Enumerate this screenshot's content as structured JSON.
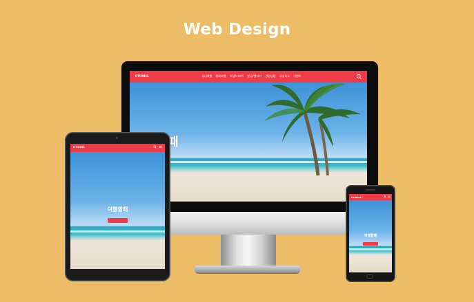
{
  "title": "Web Design",
  "site": {
    "logo": "OTIONEL",
    "hero_title": "여행할때",
    "hero_subtitle": "",
    "cta_label": ""
  },
  "desktop_nav": [
    "국내여행",
    "해외여행",
    "호텔/리조트",
    "항공/렌터카",
    "관광상품",
    "국내숙소",
    "이벤트"
  ],
  "icons": {
    "search": "search-icon",
    "menu": "hamburger-menu-icon"
  },
  "colors": {
    "background": "#EDBC67",
    "brand_red": "#EF3B45",
    "title": "#FFFFFF"
  }
}
